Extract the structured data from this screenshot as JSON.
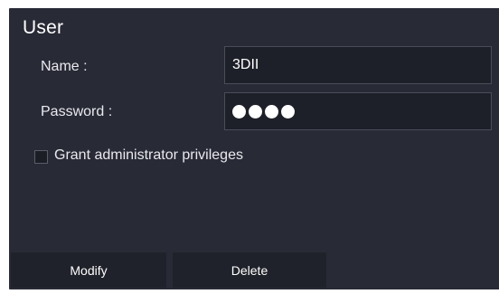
{
  "user_panel": {
    "title": "User",
    "name_label": "Name :",
    "name_value": "3DII",
    "password_label": "Password :",
    "password_length": 4,
    "grant_admin_label": "Grant administrator privileges",
    "grant_admin_checked": false,
    "modify_label": "Modify",
    "delete_label": "Delete"
  },
  "colors": {
    "panel_bg": "#282a36",
    "field_bg": "#1e2029",
    "button_bg": "#20222b",
    "text": "#ffffff"
  }
}
